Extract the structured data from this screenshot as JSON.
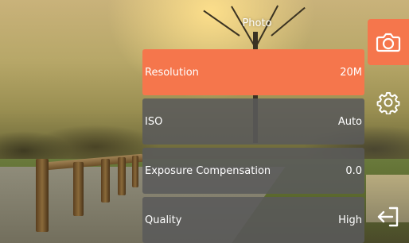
{
  "screen": {
    "title": "Photo",
    "accent_color": "#f5764c",
    "item_bg_color": "#5a5a5a"
  },
  "settings": [
    {
      "label": "Resolution",
      "value": "20M",
      "selected": true
    },
    {
      "label": "ISO",
      "value": "Auto",
      "selected": false
    },
    {
      "label": "Exposure Compensation",
      "value": "0.0",
      "selected": false
    },
    {
      "label": "Quality",
      "value": "High",
      "selected": false
    }
  ],
  "side_controls": [
    {
      "icon": "camera-icon",
      "active": true
    },
    {
      "icon": "gear-icon",
      "active": false
    },
    {
      "icon": "exit-icon",
      "active": false
    }
  ]
}
